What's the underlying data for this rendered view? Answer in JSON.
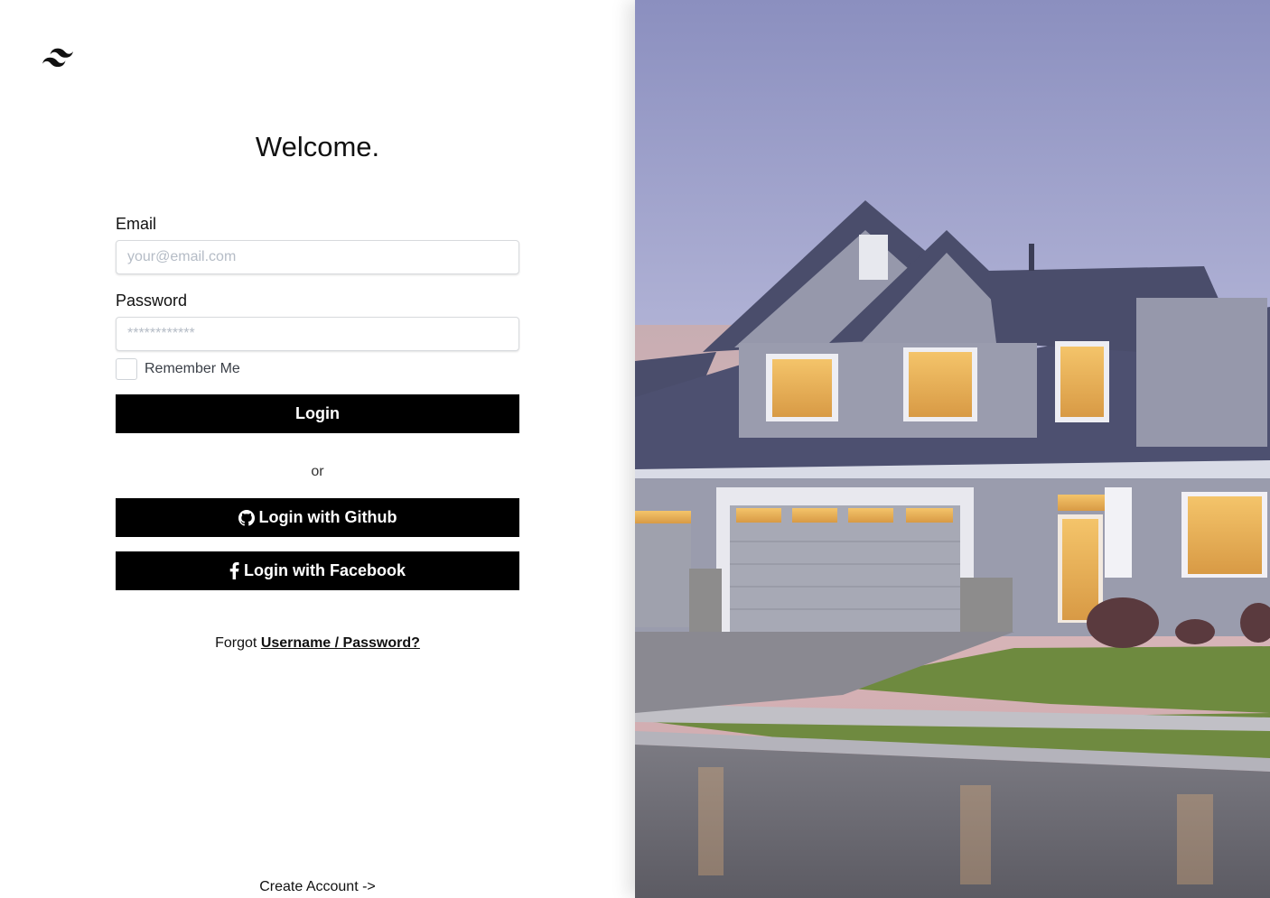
{
  "welcome": "Welcome.",
  "email": {
    "label": "Email",
    "placeholder": "your@email.com",
    "value": ""
  },
  "password": {
    "label": "Password",
    "placeholder": "************",
    "value": ""
  },
  "remember": {
    "label": "Remember Me",
    "checked": false
  },
  "login_label": "Login",
  "or_text": "or",
  "github_label": "Login with Github",
  "facebook_label": "Login with Facebook",
  "forgot": {
    "prefix": "Forgot",
    "link": "Username / Password?"
  },
  "create_account": "Create Account ->",
  "icons": {
    "logo": "tailwind-logo-icon",
    "github": "github-icon",
    "facebook": "facebook-icon"
  },
  "colors": {
    "button_bg": "#000000",
    "button_text": "#ffffff",
    "placeholder": "#b5bcc6"
  }
}
